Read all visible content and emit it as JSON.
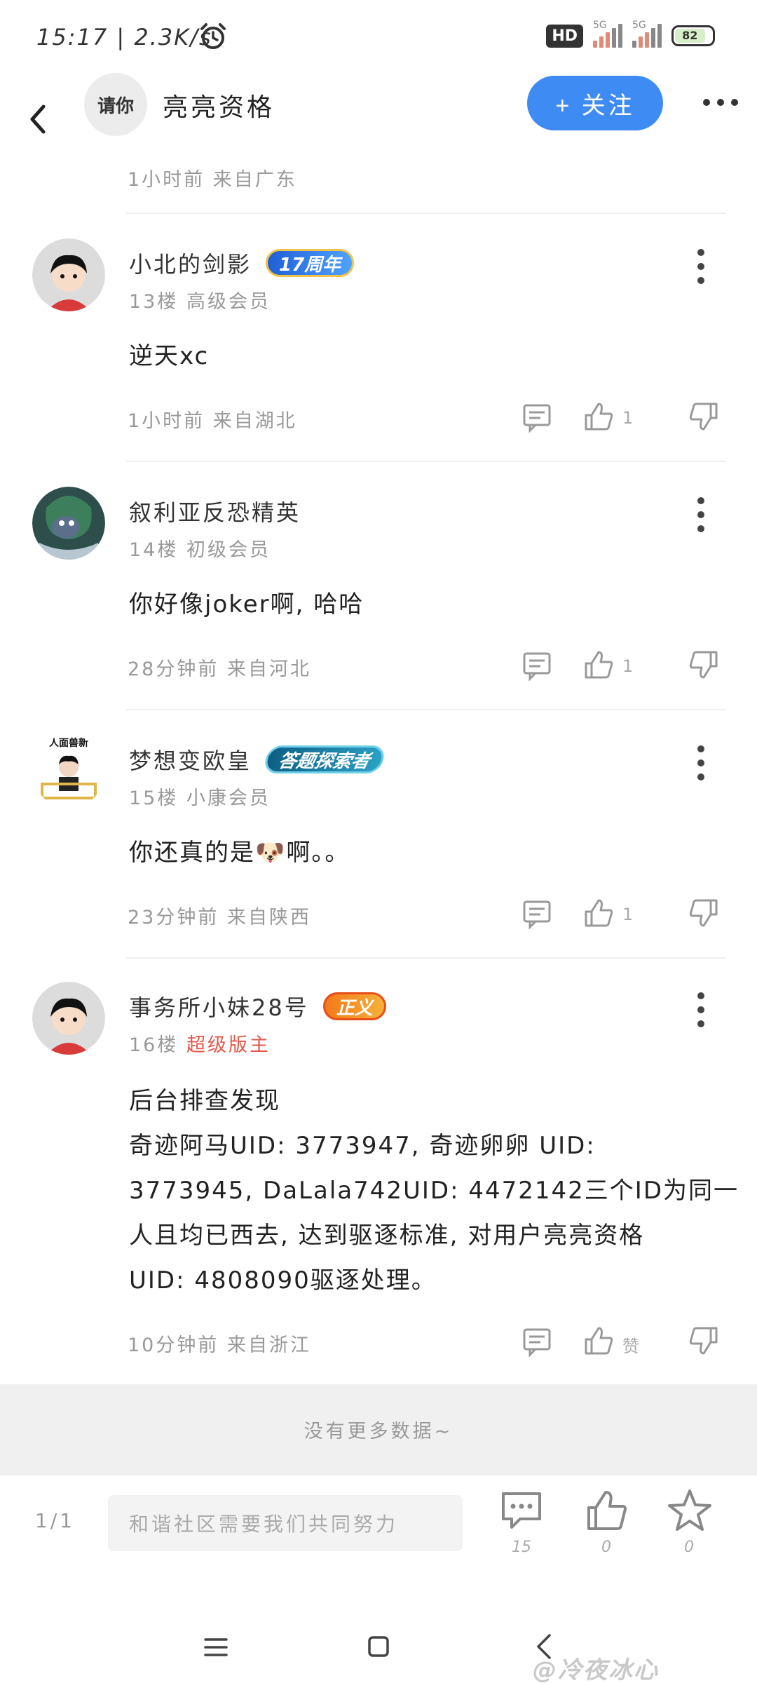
{
  "status_bar": {
    "time_speed": "15:17 | 2.3K/s",
    "hd_label": "HD",
    "net1": "5G",
    "net2": "5G",
    "battery": "82"
  },
  "header": {
    "avatar_text": "请你",
    "title": "亮亮资格",
    "follow_label": "+ 关注"
  },
  "top_meta": "1小时前 来自广东",
  "comments": [
    {
      "name": "小北的剑影",
      "badge": "17周年",
      "level": "13楼 高级会员",
      "text": "逆天xc",
      "time": "1小时前 来自湖北",
      "likes": "1"
    },
    {
      "name": "叙利亚反恐精英",
      "badge": "",
      "level": "14楼 初级会员",
      "text": "你好像joker啊, 哈哈",
      "time": "28分钟前 来自河北",
      "likes": "1"
    },
    {
      "name": "梦想变欧皇",
      "badge": "答题探索者",
      "avatar_text": "人面兽新",
      "level": "15楼 小康会员",
      "text": "你还真的是🐶啊。。",
      "time": "23分钟前 来自陕西",
      "likes": "1"
    },
    {
      "name": "事务所小妹28号",
      "badge": "正义",
      "level_floor": "16楼",
      "level_role": "超级版主",
      "text_lines": [
        "后台排查发现",
        "奇迹阿马UID: 3773947, 奇迹卵卵 UID:",
        "3773945, DaLala742UID: 4472142三个ID为同一",
        "人且均已西去, 达到驱逐标准, 对用户亮亮资格",
        "UID: 4808090驱逐处理。"
      ],
      "time": "10分钟前 来自浙江",
      "likes": "赞"
    }
  ],
  "no_more": "没有更多数据~",
  "bottom_bar": {
    "page": "1/1",
    "input_placeholder": "和谐社区需要我们共同努力",
    "comment_count": "15",
    "like_count": "0",
    "fav_count": "0"
  },
  "watermark": "@冷夜冰心"
}
